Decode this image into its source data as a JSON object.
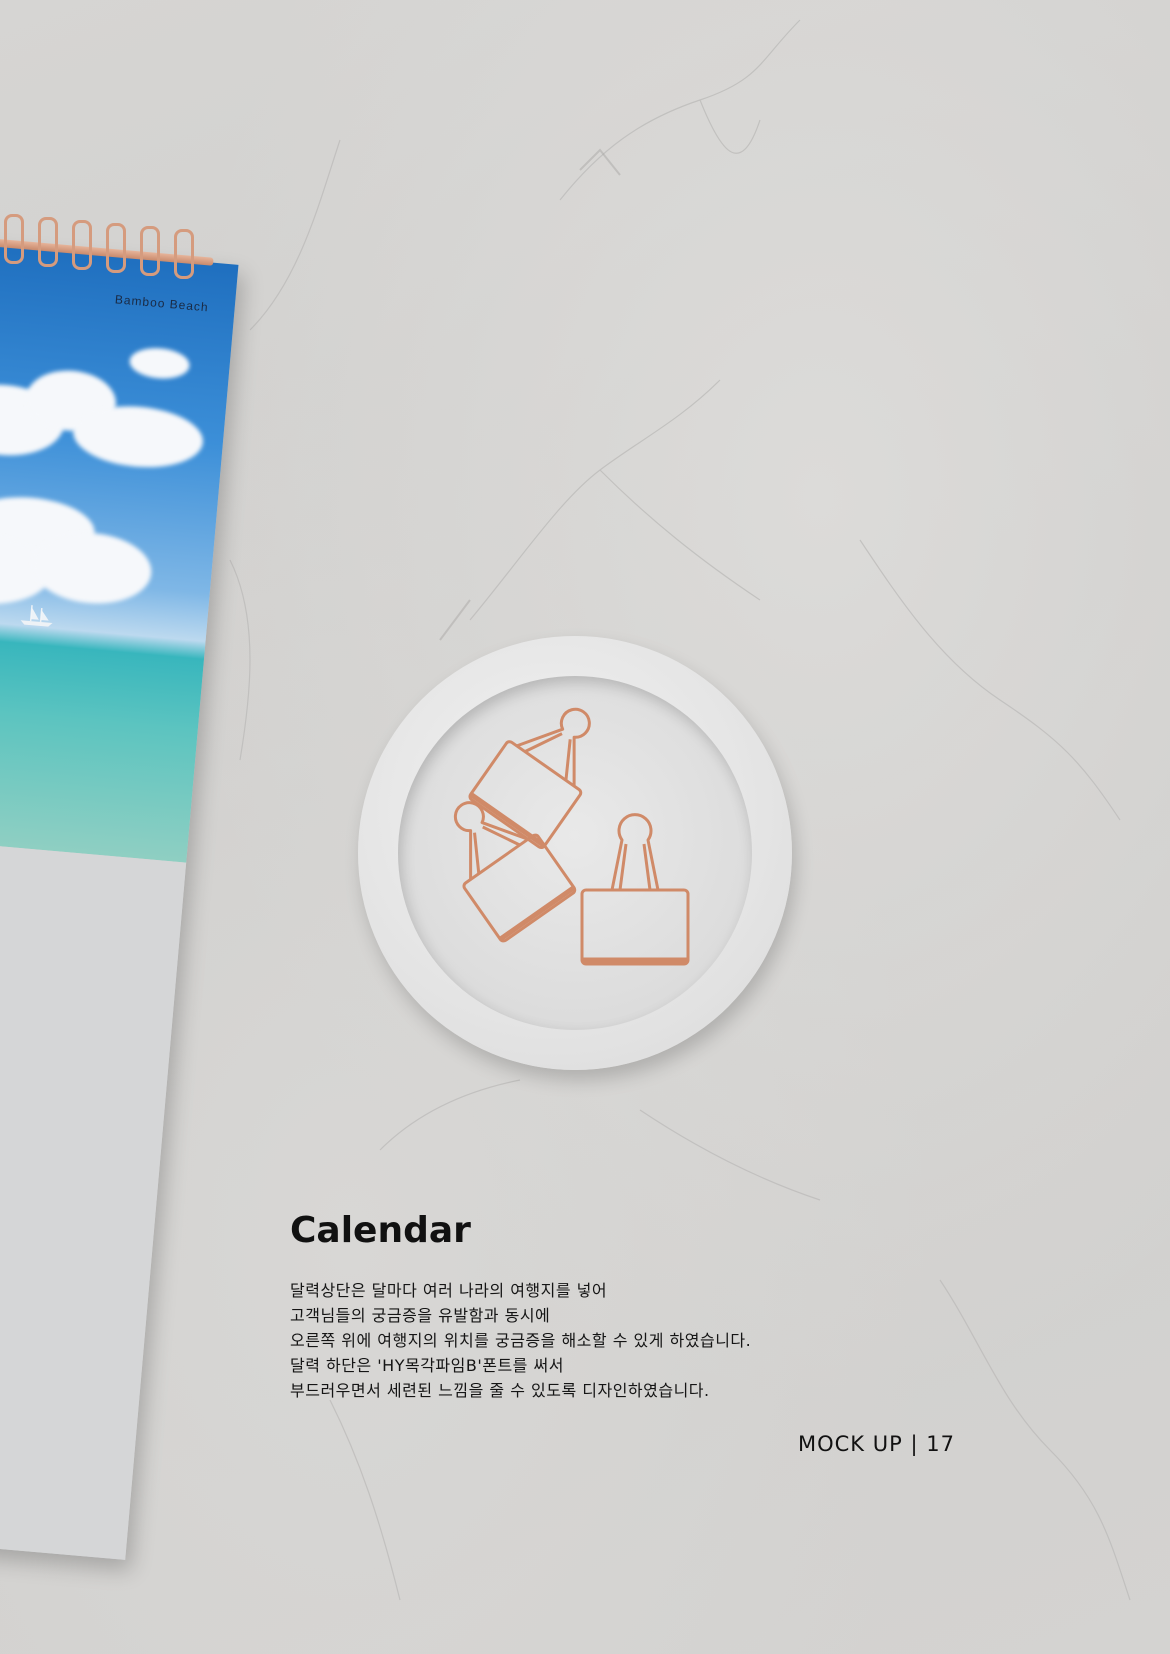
{
  "calendar": {
    "title": "Bamboo Beach"
  },
  "section": {
    "title": "Calendar",
    "description": [
      "달력상단은 달마다 여러 나라의 여행지를 넣어",
      "고객님들의 궁금증을 유발함과 동시에",
      "오른쪽 위에 여행지의 위치를 궁금증을 해소할 수 있게 하였습니다.",
      "달력 하단은 'HY목각파임B'폰트를 써서",
      "부드러우면서 세련된 느낌을 줄 수 있도록 디자인하였습니다."
    ]
  },
  "footer": {
    "label": "MOCK UP",
    "separator": "|",
    "page_number": "17"
  },
  "colors": {
    "background": "#d3d2d0",
    "clip": "#d08a68",
    "text": "#111111"
  }
}
